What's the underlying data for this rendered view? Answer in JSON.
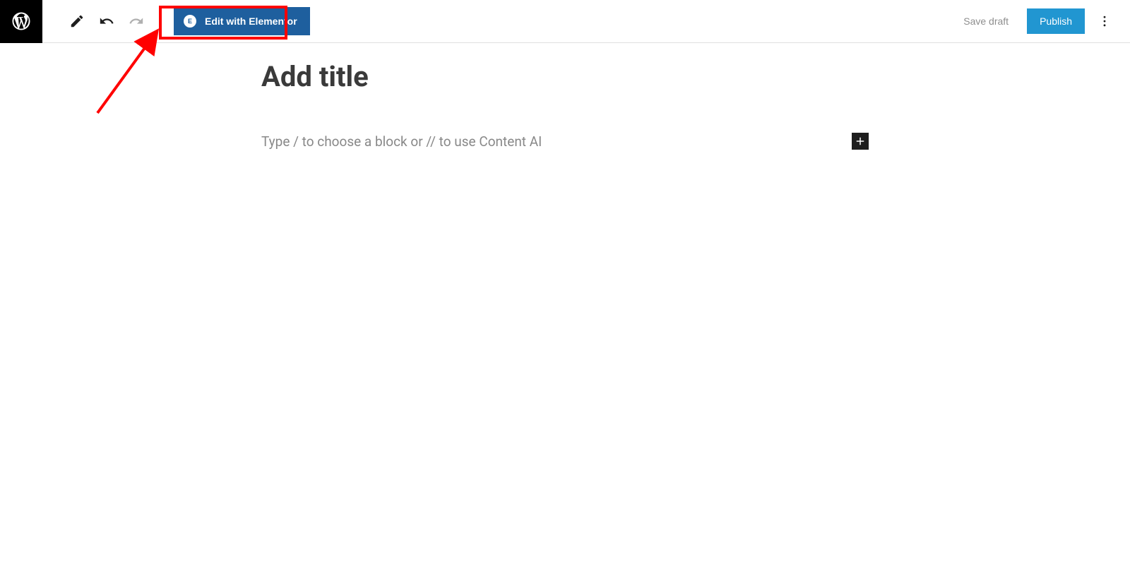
{
  "toolbar": {
    "elementor_label": "Edit with Elementor",
    "elementor_icon_text": "E",
    "save_draft_label": "Save draft",
    "publish_label": "Publish"
  },
  "editor": {
    "title_placeholder": "Add title",
    "block_placeholder": "Type / to choose a block or // to use Content AI"
  },
  "annotation": {
    "highlight_color": "#ff0000"
  }
}
